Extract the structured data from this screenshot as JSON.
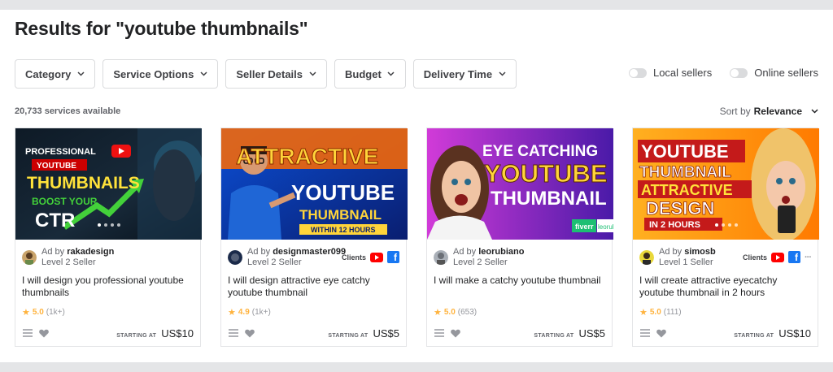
{
  "page_title": "Results for \"youtube thumbnails\"",
  "filters": [
    {
      "label": "Category"
    },
    {
      "label": "Service Options"
    },
    {
      "label": "Seller Details"
    },
    {
      "label": "Budget"
    },
    {
      "label": "Delivery Time"
    }
  ],
  "toggles": {
    "local": "Local sellers",
    "online": "Online sellers"
  },
  "results_count": "20,733 services available",
  "sort": {
    "prefix": "Sort by",
    "value": "Relevance"
  },
  "cards": [
    {
      "thumb_text": [
        "PROFESSIONAL",
        "YOUTUBE",
        "THUMBNAILS",
        "BOOST YOUR",
        "CTR"
      ],
      "ad_prefix": "Ad by",
      "seller": "rakadesign",
      "level": "Level 2 Seller",
      "clients_label": "",
      "title": "I will design you professional youtube thumbnails",
      "rating": "5.0",
      "reviews": "(1k+)",
      "price_label": "STARTING AT",
      "price": "US$10"
    },
    {
      "thumb_text": [
        "ATTRACTIVE",
        "YOUTUBE",
        "THUMBNAIL",
        "WITHIN 12 HOURS"
      ],
      "ad_prefix": "Ad by",
      "seller": "designmaster099",
      "level": "Level 2 Seller",
      "clients_label": "Clients",
      "title": "I will design attractive eye catchy youtube thumbnail",
      "rating": "4.9",
      "reviews": "(1k+)",
      "price_label": "STARTING AT",
      "price": "US$5"
    },
    {
      "thumb_text": [
        "EYE CATCHING",
        "YOUTUBE",
        "THUMBNAIL",
        "fiverr",
        "leorub"
      ],
      "ad_prefix": "Ad by",
      "seller": "leorubiano",
      "level": "Level 2 Seller",
      "clients_label": "",
      "title": "I will make a catchy youtube thumbnail",
      "rating": "5.0",
      "reviews": "(653)",
      "price_label": "STARTING AT",
      "price": "US$5"
    },
    {
      "thumb_text": [
        "YOUTUBE",
        "THUMBNAIL",
        "ATTRACTIVE",
        "DESIGN",
        "IN 2 HOURS"
      ],
      "ad_prefix": "Ad by",
      "seller": "simosb",
      "level": "Level 1 Seller",
      "clients_label": "Clients",
      "title": "I will create attractive eyecatchy youtube thumbnail in 2 hours",
      "rating": "5.0",
      "reviews": "(111)",
      "price_label": "STARTING AT",
      "price": "US$10"
    }
  ],
  "colors": {
    "star": "#ffb33e",
    "youtube": "#ff0000",
    "facebook": "#1877f2"
  }
}
